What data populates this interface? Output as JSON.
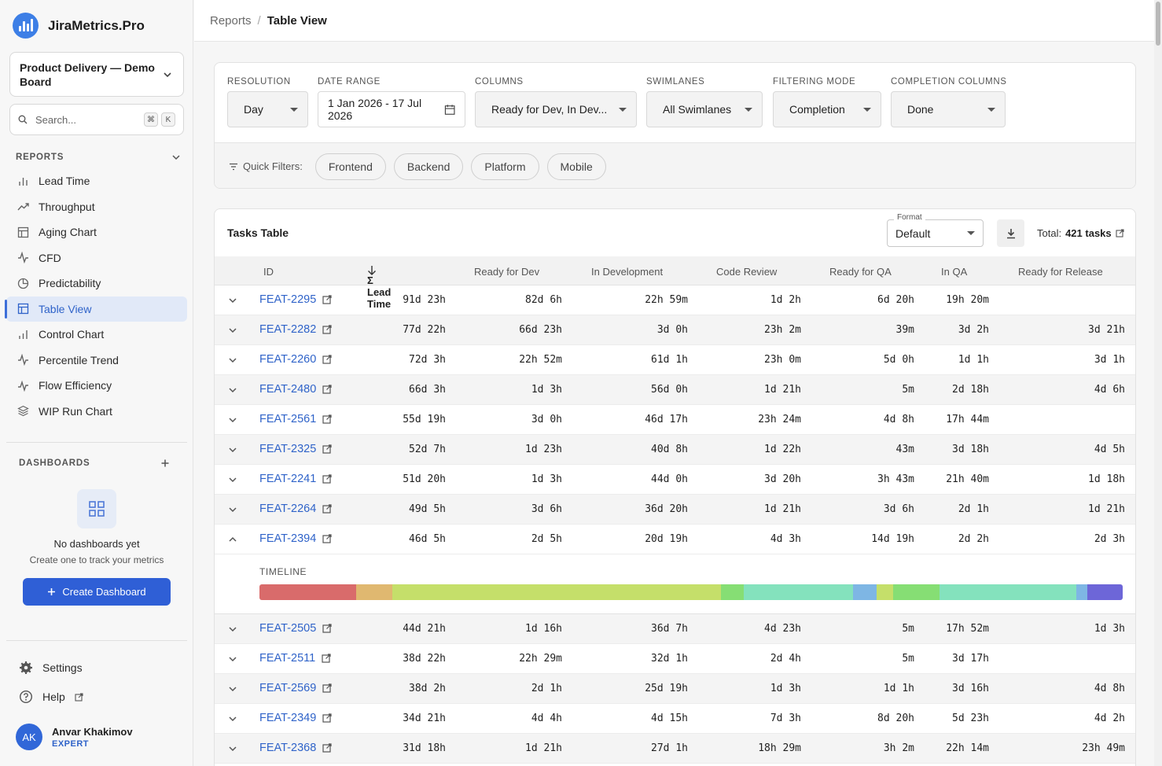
{
  "app": {
    "name": "JiraMetrics.Pro"
  },
  "board": {
    "name": "Product Delivery — Demo Board"
  },
  "search": {
    "placeholder": "Search...",
    "kbd1": "⌘",
    "kbd2": "K"
  },
  "sidebar": {
    "reports_heading": "REPORTS",
    "items": [
      {
        "label": "Lead Time",
        "icon": "bar-chart-icon"
      },
      {
        "label": "Throughput",
        "icon": "trend-up-icon"
      },
      {
        "label": "Aging Chart",
        "icon": "table-icon"
      },
      {
        "label": "CFD",
        "icon": "activity-icon"
      },
      {
        "label": "Predictability",
        "icon": "pie-chart-icon"
      },
      {
        "label": "Table View",
        "icon": "table-icon",
        "active": true
      },
      {
        "label": "Control Chart",
        "icon": "bar-chart-icon"
      },
      {
        "label": "Percentile Trend",
        "icon": "trend-up-icon"
      },
      {
        "label": "Flow Efficiency",
        "icon": "activity-icon"
      },
      {
        "label": "WIP Run Chart",
        "icon": "layers-icon"
      }
    ],
    "dashboards_heading": "DASHBOARDS",
    "empty_title": "No dashboards yet",
    "empty_sub": "Create one to track your metrics",
    "create_label": "Create Dashboard",
    "settings_label": "Settings",
    "help_label": "Help"
  },
  "user": {
    "initials": "AK",
    "name": "Anvar Khakimov",
    "role": "EXPERT"
  },
  "breadcrumb": {
    "parent": "Reports",
    "sep": "/",
    "current": "Table View"
  },
  "filters": {
    "resolution": {
      "label": "RESOLUTION",
      "value": "Day"
    },
    "date_range": {
      "label": "DATE RANGE",
      "value": "1 Jan 2026 - 17 Jul 2026"
    },
    "columns": {
      "label": "COLUMNS",
      "value": "Ready for Dev, In Dev..."
    },
    "swimlanes": {
      "label": "SWIMLANES",
      "value": "All Swimlanes"
    },
    "filtering_mode": {
      "label": "FILTERING MODE",
      "value": "Completion"
    },
    "completion_columns": {
      "label": "COMPLETION COLUMNS",
      "value": "Done"
    },
    "quick_label": "Quick Filters:",
    "quick_filters": [
      "Frontend",
      "Backend",
      "Platform",
      "Mobile"
    ]
  },
  "table": {
    "title": "Tasks Table",
    "format_legend": "Format",
    "format_value": "Default",
    "total_label": "Total:",
    "total_value": "421 tasks",
    "columns": [
      "ID",
      "Σ Lead Time",
      "Ready for Dev",
      "In Development",
      "Code Review",
      "Ready for QA",
      "In QA",
      "Ready for Release"
    ],
    "timeline_label": "TIMELINE",
    "rows": [
      {
        "id": "FEAT-2295",
        "lead": "91d 23h",
        "rfd": "82d 6h",
        "dev": "22h 59m",
        "cr": "1d 2h",
        "rqa": "6d 20h",
        "qa": "19h 20m",
        "rfr": ""
      },
      {
        "id": "FEAT-2282",
        "lead": "77d 22h",
        "rfd": "66d 23h",
        "dev": "3d 0h",
        "cr": "23h 2m",
        "rqa": "39m",
        "qa": "3d 2h",
        "rfr": "3d 21h"
      },
      {
        "id": "FEAT-2260",
        "lead": "72d 3h",
        "rfd": "22h 52m",
        "dev": "61d 1h",
        "cr": "23h 0m",
        "rqa": "5d 0h",
        "qa": "1d 1h",
        "rfr": "3d 1h"
      },
      {
        "id": "FEAT-2480",
        "lead": "66d 3h",
        "rfd": "1d 3h",
        "dev": "56d 0h",
        "cr": "1d 21h",
        "rqa": "5m",
        "qa": "2d 18h",
        "rfr": "4d 6h"
      },
      {
        "id": "FEAT-2561",
        "lead": "55d 19h",
        "rfd": "3d 0h",
        "dev": "46d 17h",
        "cr": "23h 24m",
        "rqa": "4d 8h",
        "qa": "17h 44m",
        "rfr": ""
      },
      {
        "id": "FEAT-2325",
        "lead": "52d 7h",
        "rfd": "1d 23h",
        "dev": "40d 8h",
        "cr": "1d 22h",
        "rqa": "43m",
        "qa": "3d 18h",
        "rfr": "4d 5h"
      },
      {
        "id": "FEAT-2241",
        "lead": "51d 20h",
        "rfd": "1d 3h",
        "dev": "44d 0h",
        "cr": "3d 20h",
        "rqa": "3h 43m",
        "qa": "21h 40m",
        "rfr": "1d 18h"
      },
      {
        "id": "FEAT-2264",
        "lead": "49d 5h",
        "rfd": "3d 6h",
        "dev": "36d 20h",
        "cr": "1d 21h",
        "rqa": "3d 6h",
        "qa": "2d 1h",
        "rfr": "1d 21h"
      },
      {
        "id": "FEAT-2394",
        "lead": "46d 5h",
        "rfd": "2d 5h",
        "dev": "20d 19h",
        "cr": "4d 3h",
        "rqa": "14d 19h",
        "qa": "2d 2h",
        "rfr": "2d 3h",
        "expanded": true
      },
      {
        "id": "FEAT-2505",
        "lead": "44d 21h",
        "rfd": "1d 16h",
        "dev": "36d 7h",
        "cr": "4d 23h",
        "rqa": "5m",
        "qa": "17h 52m",
        "rfr": "1d 3h"
      },
      {
        "id": "FEAT-2511",
        "lead": "38d 22h",
        "rfd": "22h 29m",
        "dev": "32d 1h",
        "cr": "2d 4h",
        "rqa": "5m",
        "qa": "3d 17h",
        "rfr": ""
      },
      {
        "id": "FEAT-2569",
        "lead": "38d 2h",
        "rfd": "2d 1h",
        "dev": "25d 19h",
        "cr": "1d 3h",
        "rqa": "1d 1h",
        "qa": "3d 16h",
        "rfr": "4d 8h"
      },
      {
        "id": "FEAT-2349",
        "lead": "34d 21h",
        "rfd": "4d 4h",
        "dev": "4d 15h",
        "cr": "7d 3h",
        "rqa": "8d 20h",
        "qa": "5d 23h",
        "rfr": "4d 2h"
      },
      {
        "id": "FEAT-2368",
        "lead": "31d 18h",
        "rfd": "1d 21h",
        "dev": "27d 1h",
        "cr": "18h 29m",
        "rqa": "3h 2m",
        "qa": "22h 14m",
        "rfr": "23h 49m"
      }
    ],
    "timeline_segments": [
      {
        "color": "#d96b6b",
        "share": 0.112
      },
      {
        "color": "#e0b870",
        "share": 0.042
      },
      {
        "color": "#c5df6a",
        "share": 0.381
      },
      {
        "color": "#86de74",
        "share": 0.026
      },
      {
        "color": "#84e2bd",
        "share": 0.127
      },
      {
        "color": "#7eb6e4",
        "share": 0.027
      },
      {
        "color": "#c5df6a",
        "share": 0.019
      },
      {
        "color": "#86de74",
        "share": 0.054
      },
      {
        "color": "#84e2bd",
        "share": 0.158
      },
      {
        "color": "#7eb6e4",
        "share": 0.013
      },
      {
        "color": "#6d66d8",
        "share": 0.041
      }
    ]
  },
  "colors": {
    "accent": "#2f63c9",
    "button": "#2f5fd6",
    "active_bg": "#e1e9f8"
  }
}
